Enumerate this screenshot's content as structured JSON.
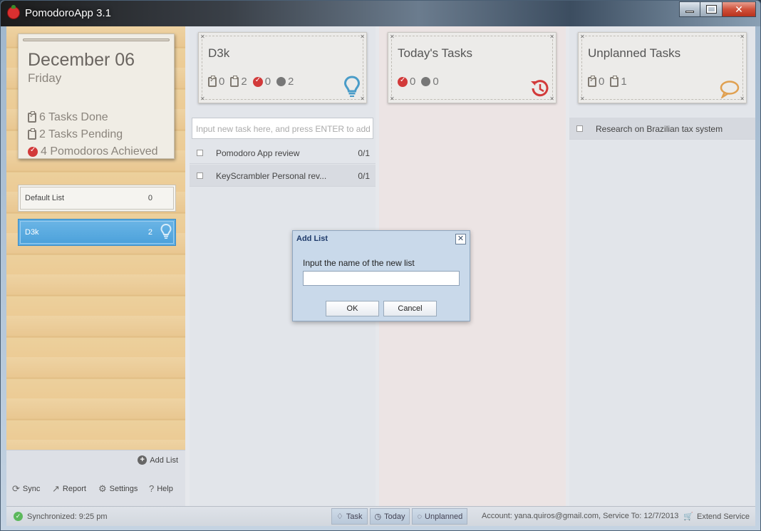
{
  "window": {
    "title": "PomodoroApp 3.1"
  },
  "sidebar": {
    "date": "December 06",
    "weekday": "Friday",
    "stats": {
      "done": "6 Tasks Done",
      "pending": "2 Tasks Pending",
      "pomodoros": "4 Pomodoros Achieved"
    },
    "lists": [
      {
        "name": "Default List",
        "count": "0"
      },
      {
        "name": "D3k",
        "count": "2"
      }
    ],
    "add_list_label": "Add List",
    "tools": {
      "sync": "Sync",
      "report": "Report",
      "settings": "Settings",
      "help": "Help"
    }
  },
  "columns": [
    {
      "title": "D3k",
      "stats": [
        "0",
        "2",
        "0",
        "2"
      ],
      "input_placeholder": "Input new task here, and press ENTER to add",
      "tasks": [
        {
          "name": "Pomodoro App review",
          "progress": "0/1"
        },
        {
          "name": "KeyScrambler Personal rev...",
          "progress": "0/1"
        }
      ]
    },
    {
      "title": "Today's Tasks",
      "stats": [
        "0",
        "0"
      ]
    },
    {
      "title": "Unplanned Tasks",
      "stats": [
        "0",
        "1"
      ],
      "tasks": [
        {
          "name": "Research on Brazilian tax system"
        }
      ]
    }
  ],
  "dialog": {
    "title": "Add List",
    "label": "Input the name of the new list",
    "ok": "OK",
    "cancel": "Cancel"
  },
  "statusbar": {
    "sync_status": "Synchronized: 9:25 pm",
    "tabs": [
      "Task",
      "Today",
      "Unplanned"
    ],
    "account": "Account: yana.quiros@gmail.com, Service To: 12/7/2013",
    "extend": "Extend Service"
  },
  "colors": {
    "accent_blue": "#4aa0da",
    "tomato_red": "#d23a3a",
    "bulb_blue": "#4a9cc8",
    "bubble_orange": "#e0a050"
  }
}
